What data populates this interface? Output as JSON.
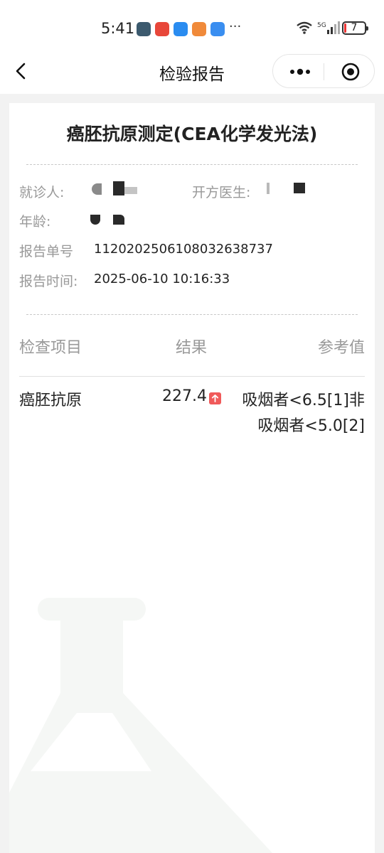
{
  "status_bar": {
    "time": "5:41",
    "more": "···",
    "network": "5G",
    "battery": "7",
    "app_icons": [
      {
        "name": "gallery-app-icon",
        "color": "#3c5a6e"
      },
      {
        "name": "red-app-icon",
        "color": "#e8473a"
      },
      {
        "name": "chat-app-icon",
        "color": "#2a8cf0"
      },
      {
        "name": "health-app-icon",
        "color": "#f08a3a"
      },
      {
        "name": "cloud-app-icon",
        "color": "#3a8ef0"
      }
    ]
  },
  "nav": {
    "title": "检验报告",
    "back_icon": "chevron-left-icon",
    "more_icon": "more-dots-icon",
    "close_icon": "target-circle-icon"
  },
  "report": {
    "title": "癌胚抗原测定(CEA化学发光法)",
    "patient_label": "就诊人:",
    "doctor_label": "开方医生:",
    "age_label": "年龄:",
    "report_no_label": "报告单号",
    "report_no": "1120202506108032638737",
    "report_time_label": "报告时间:",
    "report_time": "2025-06-10 10:16:33"
  },
  "table": {
    "headers": [
      "检查项目",
      "结果",
      "参考值"
    ],
    "rows": [
      {
        "item": "癌胚抗原",
        "result": "227.4",
        "flag": "up-arrow-icon",
        "reference_line1": "吸烟者<6.5[1]非",
        "reference_line2": "吸烟者<5.0[2]"
      }
    ]
  },
  "colors": {
    "abnormal_flag": "#f05a5a",
    "label_grey": "#999999",
    "watermark": "#f5f7f5"
  }
}
